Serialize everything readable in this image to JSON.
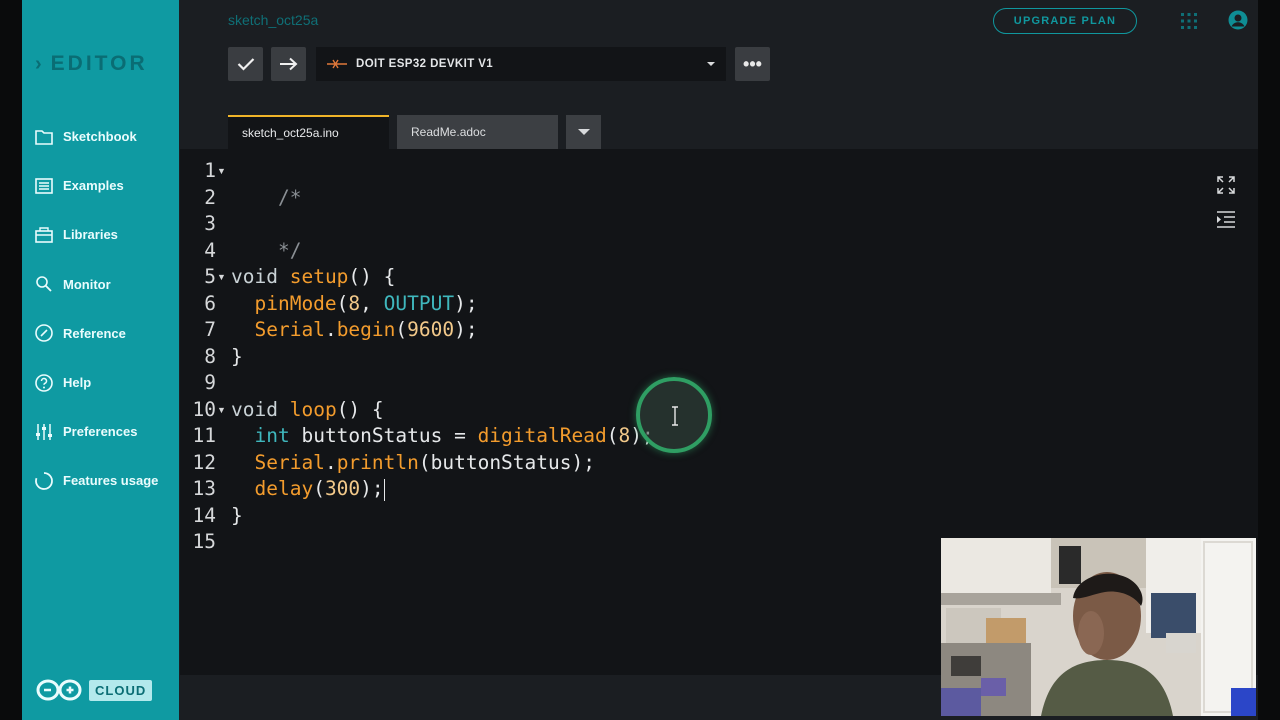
{
  "app": {
    "brand": "EDITOR",
    "sketch_title": "sketch_oct25a",
    "upgrade_label": "UPGRADE PLAN"
  },
  "sidebar": {
    "items": [
      {
        "label": "Sketchbook",
        "icon": "folder-icon"
      },
      {
        "label": "Examples",
        "icon": "list-icon"
      },
      {
        "label": "Libraries",
        "icon": "library-icon"
      },
      {
        "label": "Monitor",
        "icon": "monitor-search-icon"
      },
      {
        "label": "Reference",
        "icon": "reference-icon"
      },
      {
        "label": "Help",
        "icon": "help-icon"
      },
      {
        "label": "Preferences",
        "icon": "sliders-icon"
      },
      {
        "label": "Features usage",
        "icon": "circle-progress-icon"
      }
    ],
    "cloud_label": "CLOUD"
  },
  "toolbar": {
    "verify_icon": "check-icon",
    "upload_icon": "arrow-right-icon",
    "board": "DOIT ESP32 DEVKIT V1",
    "more_icon": "more-icon"
  },
  "tabs": [
    {
      "label": "sketch_oct25a.ino",
      "active": true
    },
    {
      "label": "ReadMe.adoc",
      "active": false
    }
  ],
  "editor": {
    "line_numbers": [
      "1",
      "2",
      "3",
      "4",
      "5",
      "6",
      "7",
      "8",
      "9",
      "10",
      "11",
      "12",
      "13",
      "14",
      "15"
    ],
    "tokens": {
      "l1": "/*",
      "l3": "*/",
      "void": "void",
      "setup": "setup",
      "setup_rest": "() {",
      "indent": "  ",
      "pinMode": "pinMode",
      "pin_open": "(",
      "eight": "8",
      "comma": ", ",
      "OUTPUT": "OUTPUT",
      "close_semi": ");",
      "Serial": "Serial",
      "dot": ".",
      "begin": "begin",
      "baud": "9600",
      "brace_close": "}",
      "loop": "loop",
      "loop_rest": "() {",
      "int": "int",
      "buttonStatus_decl": " buttonStatus = ",
      "digitalRead": "digitalRead",
      "println": "println",
      "println_arg": "(buttonStatus);",
      "delay": "delay",
      "delay_val": "300",
      "space": " "
    }
  },
  "colors": {
    "sidebar": "#0f9aa2",
    "accent_tab": "#f0b429",
    "editor_bg": "#121417"
  }
}
